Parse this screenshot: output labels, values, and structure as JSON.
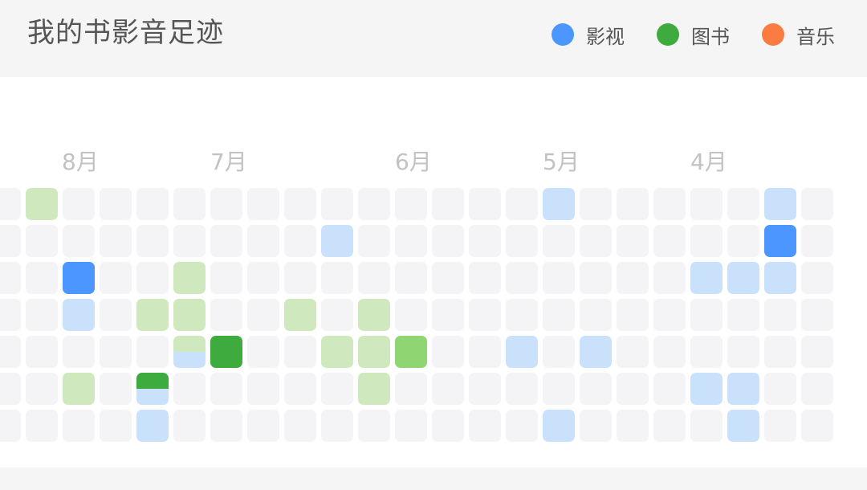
{
  "header": {
    "title": "我的书影音足迹"
  },
  "legend": [
    {
      "key": "film",
      "label": "影视",
      "color": "#4b97ff",
      "icon": "blue-dot"
    },
    {
      "key": "book",
      "label": "图书",
      "color": "#3dab3d",
      "icon": "green-dot"
    },
    {
      "key": "music",
      "label": "音乐",
      "color": "#fb7c43",
      "icon": "orange-dot"
    }
  ],
  "months": [
    "8月",
    "7月",
    "6月",
    "5月",
    "4月"
  ],
  "palette": {
    "empty": "#f4f4f6",
    "film_light": "#cae1fb",
    "film_dark": "#4b97ff",
    "book_light": "#cfe8bd",
    "book_mid": "#8fd572",
    "book_dark": "#3dab3d"
  },
  "activity_grid": {
    "rows": 7,
    "columns": 23,
    "cells": [
      {
        "row": 0,
        "col": 1,
        "level": "book_light"
      },
      {
        "row": 0,
        "col": 15,
        "level": "film_light"
      },
      {
        "row": 0,
        "col": 21,
        "level": "film_light"
      },
      {
        "row": 1,
        "col": 9,
        "level": "film_light"
      },
      {
        "row": 1,
        "col": 21,
        "level": "film_dark"
      },
      {
        "row": 2,
        "col": 2,
        "level": "film_dark"
      },
      {
        "row": 2,
        "col": 5,
        "level": "book_light"
      },
      {
        "row": 2,
        "col": 19,
        "level": "film_light"
      },
      {
        "row": 2,
        "col": 20,
        "level": "film_light"
      },
      {
        "row": 2,
        "col": 21,
        "level": "film_light"
      },
      {
        "row": 3,
        "col": 2,
        "level": "film_light"
      },
      {
        "row": 3,
        "col": 4,
        "level": "book_light"
      },
      {
        "row": 3,
        "col": 5,
        "level": "book_light"
      },
      {
        "row": 3,
        "col": 8,
        "level": "book_light"
      },
      {
        "row": 3,
        "col": 10,
        "level": "book_light"
      },
      {
        "row": 4,
        "col": 5,
        "level": "book_light",
        "bottom": "film_light"
      },
      {
        "row": 4,
        "col": 6,
        "level": "book_dark"
      },
      {
        "row": 4,
        "col": 9,
        "level": "book_light"
      },
      {
        "row": 4,
        "col": 10,
        "level": "book_light"
      },
      {
        "row": 4,
        "col": 11,
        "level": "book_mid"
      },
      {
        "row": 4,
        "col": 14,
        "level": "film_light"
      },
      {
        "row": 4,
        "col": 16,
        "level": "film_light"
      },
      {
        "row": 5,
        "col": 2,
        "level": "book_light"
      },
      {
        "row": 5,
        "col": 4,
        "level": "book_dark",
        "bottom": "film_light"
      },
      {
        "row": 5,
        "col": 10,
        "level": "book_light"
      },
      {
        "row": 5,
        "col": 19,
        "level": "film_light"
      },
      {
        "row": 5,
        "col": 20,
        "level": "film_light"
      },
      {
        "row": 6,
        "col": 4,
        "level": "film_light"
      },
      {
        "row": 6,
        "col": 15,
        "level": "film_light"
      },
      {
        "row": 6,
        "col": 20,
        "level": "film_light"
      }
    ]
  }
}
